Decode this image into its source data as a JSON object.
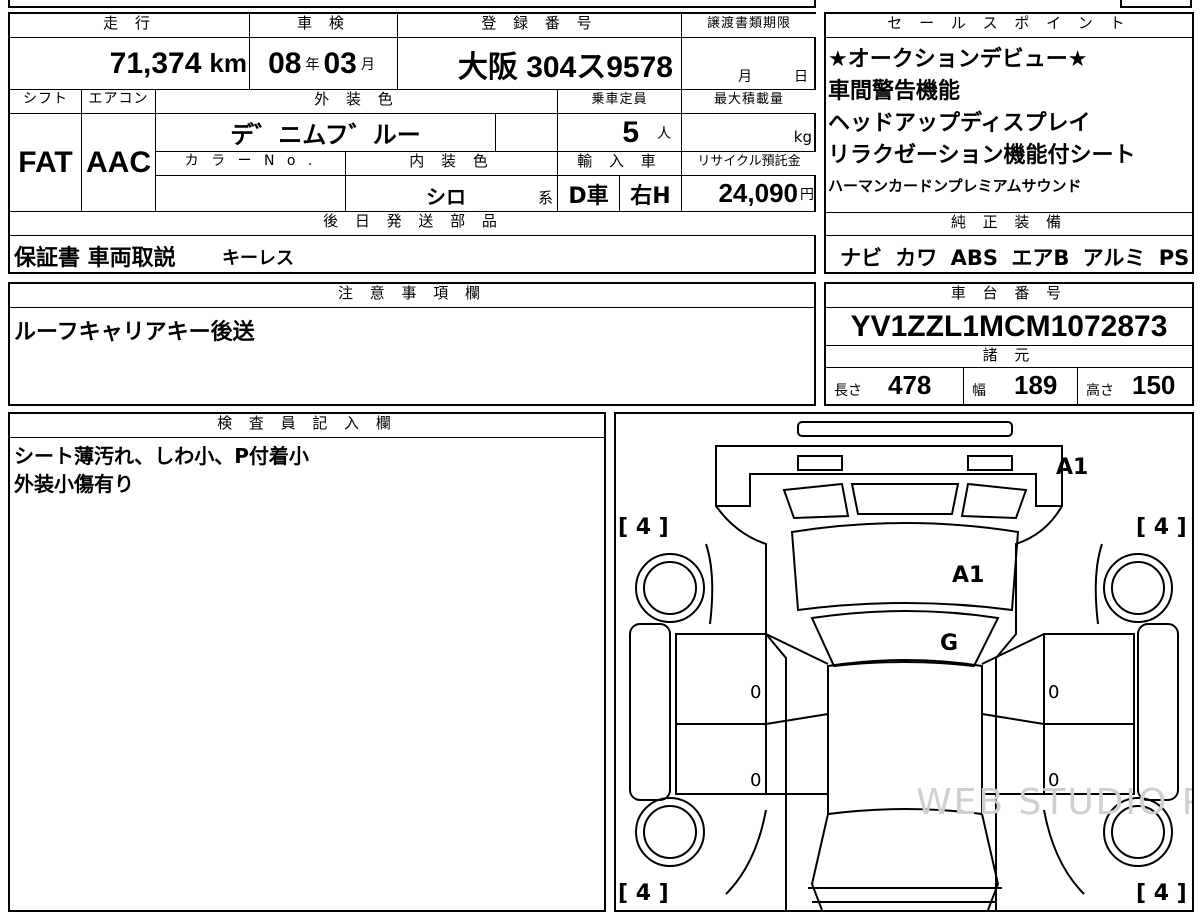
{
  "header": {
    "mileage_label": "走 行",
    "inspection_label": "車 検",
    "registration_label": "登 録 番 号",
    "transfer_deadline_label": "譲渡書類期限",
    "sales_points_label": "セ ー ル ス ポ イ ン ト"
  },
  "vehicle": {
    "mileage_value": "71,374",
    "mileage_unit": "km",
    "inspection_year": "08",
    "inspection_year_unit": "年",
    "inspection_month": "03",
    "inspection_month_unit": "月",
    "registration": "大阪 304ス9578",
    "transfer_month_unit": "月",
    "transfer_day_unit": "日"
  },
  "specs": {
    "shift_label": "シフト",
    "aircon_label": "エアコン",
    "exterior_color_label": "外 装 色",
    "capacity_label": "乗車定員",
    "max_load_label": "最大積載量",
    "shift_value": "FAT",
    "aircon_value": "AAC",
    "exterior_color_value": "デ゛ニムフ゛ルー",
    "capacity_value": "5",
    "capacity_unit": "人",
    "max_load_unit": "kg",
    "color_no_label": "カ ラ ー N o .",
    "interior_color_label": "内 装 色",
    "import_label": "輸 入 車",
    "recycle_label": "リサイクル預託金",
    "interior_color_value": "シロ",
    "interior_color_suffix": "系",
    "import_drive": "D車",
    "import_handle": "右H",
    "recycle_value": "24,090",
    "recycle_unit": "円"
  },
  "sales_points": [
    "★オークションデビュー★",
    "車間警告機能",
    "ヘッドアップディスプレイ",
    "リラクゼーション機能付シート",
    "ハーマンカードンプレミアムサウンド"
  ],
  "later_parts": {
    "label": "後 日 発 送 部 品",
    "value_main": "保証書 車両取説",
    "value_sub": "キーレス"
  },
  "genuine_equipment": {
    "label": "純 正 装 備",
    "value": "ナビ カワ ABS エアB アルミ PS PW"
  },
  "notes": {
    "label": "注 意 事 項 欄",
    "value": "ルーフキャリアキー後送"
  },
  "chassis": {
    "label": "車 台 番 号",
    "value": "YV1ZZL1MCM1072873",
    "spec_label": "諸 元",
    "length_label": "長さ",
    "length_value": "478",
    "width_label": "幅",
    "width_value": "189",
    "height_label": "高さ",
    "height_value": "150"
  },
  "inspector": {
    "label": "検 査 員 記 入 欄",
    "lines": [
      "シート薄汚れ、しわ小、P付着小",
      "外装小傷有り"
    ]
  },
  "diagram": {
    "marks": {
      "rear_a1": "A1",
      "roof_a1": "A1",
      "glass_g": "G",
      "tire_tl": "[ 4 ]",
      "tire_tr": "[ 4 ]",
      "tire_bl": "[ 4 ]",
      "tire_br": "[ 4 ]",
      "door_l1": "0",
      "door_l2": "0",
      "door_r1": "0",
      "door_r2": "0"
    },
    "watermark": "WEB STUDIO PRO"
  }
}
